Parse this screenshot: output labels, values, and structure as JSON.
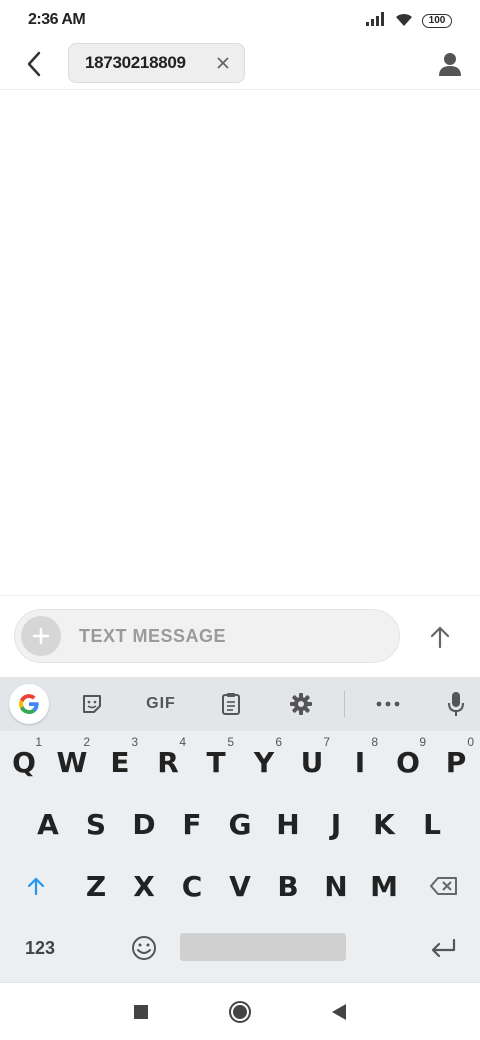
{
  "status_bar": {
    "time": "2:36 AM",
    "battery": "100",
    "icons": [
      "signal-icon",
      "wifi-icon",
      "battery-icon"
    ]
  },
  "header": {
    "back_icon": "chevron-left-icon",
    "recipient": "18730218809",
    "remove_icon": "close-icon",
    "contact_icon": "person-icon"
  },
  "compose": {
    "add_icon": "plus-icon",
    "placeholder": "TEXT MESSAGE",
    "value": "",
    "send_icon": "arrow-up-icon"
  },
  "keyboard": {
    "toolbar": {
      "google": "google-icon",
      "sticker": "sticker-icon",
      "gif_label": "GIF",
      "clipboard": "clipboard-icon",
      "settings": "gear-icon",
      "more": "more-horizontal-icon",
      "mic": "microphone-icon"
    },
    "row1": [
      {
        "key": "Q",
        "hint": "1"
      },
      {
        "key": "W",
        "hint": "2"
      },
      {
        "key": "E",
        "hint": "3"
      },
      {
        "key": "R",
        "hint": "4"
      },
      {
        "key": "T",
        "hint": "5"
      },
      {
        "key": "Y",
        "hint": "6"
      },
      {
        "key": "U",
        "hint": "7"
      },
      {
        "key": "I",
        "hint": "8"
      },
      {
        "key": "O",
        "hint": "9"
      },
      {
        "key": "P",
        "hint": "0"
      }
    ],
    "row2": [
      "A",
      "S",
      "D",
      "F",
      "G",
      "H",
      "J",
      "K",
      "L"
    ],
    "row3": [
      "Z",
      "X",
      "C",
      "V",
      "B",
      "N",
      "M"
    ],
    "shift_icon": "shift-arrow-icon",
    "backspace_icon": "backspace-icon",
    "numbers_label": "123",
    "emoji_icon": "emoji-icon",
    "enter_icon": "enter-icon"
  },
  "nav_bar": {
    "recents": "square-icon",
    "home": "circle-icon",
    "back": "triangle-back-icon"
  },
  "colors": {
    "accent": "#2196f3",
    "keyboard_bg": "#eceff1",
    "toolbar_bg": "#e3e6e8"
  }
}
